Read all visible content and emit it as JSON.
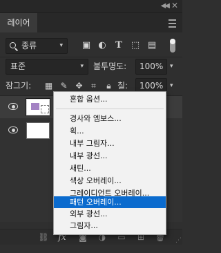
{
  "panel": {
    "tab_label": "레이어"
  },
  "filter": {
    "kind_label": "종류"
  },
  "blend": {
    "mode": "표준",
    "opacity_label": "불투명도:",
    "opacity_value": "100%"
  },
  "lock": {
    "label": "잠그기:",
    "fill_label": "칠:",
    "fill_value": "100%"
  },
  "menu": {
    "items": [
      "혼합 옵션...",
      "경사와 엠보스...",
      "획...",
      "내부 그림자...",
      "내부 광선...",
      "새틴...",
      "색상 오버레이...",
      "그레이디언트 오버레이...",
      "패턴 오버레이...",
      "외부 광선...",
      "그림자..."
    ],
    "highlighted_item": "패턴 오버레이..."
  },
  "icons": {
    "bottom": [
      "link-icon",
      "fx-icon",
      "mask-icon",
      "adjustment-icon",
      "folder-icon",
      "new-layer-icon",
      "trash-icon"
    ]
  },
  "colors": {
    "highlight": "#0b6bce",
    "swatch": "#a483c4"
  }
}
